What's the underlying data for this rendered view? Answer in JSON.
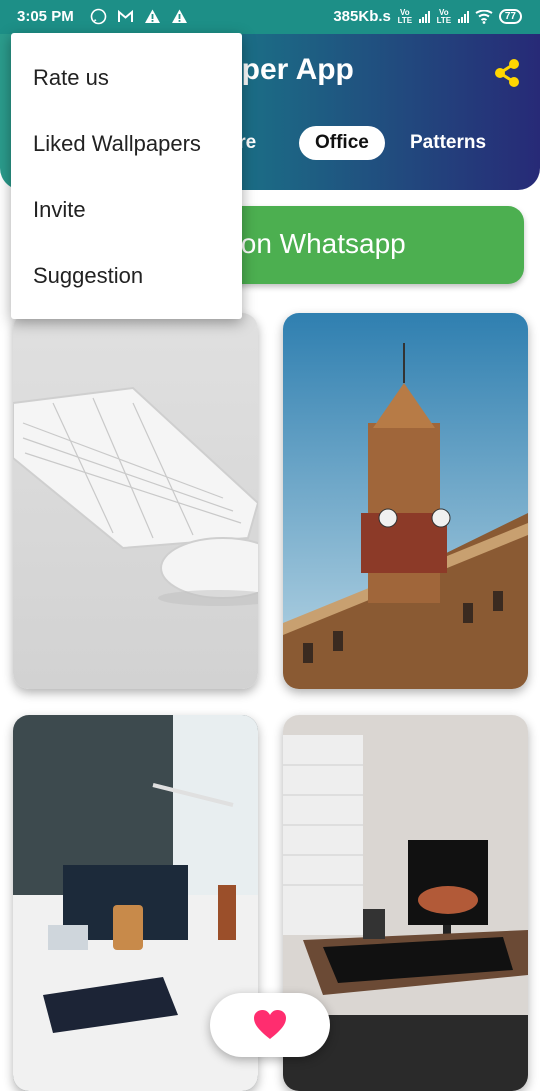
{
  "status_bar": {
    "time": "3:05 PM",
    "speed": "385Kb.s",
    "battery": "77",
    "network_label": "Vo LTE",
    "icons": [
      "whatsapp-icon",
      "gmail-icon",
      "warning-icon",
      "warning-icon",
      "signal-icon",
      "wifi-icon",
      "battery-icon"
    ]
  },
  "header": {
    "title": "Wallpaper App",
    "share_icon": "share-icon",
    "tabs": [
      {
        "label": "Nature",
        "active": false
      },
      {
        "label": "Office",
        "active": true
      },
      {
        "label": "Patterns",
        "active": false
      }
    ]
  },
  "whatsapp_button": {
    "label": "Share on Whatsapp"
  },
  "menu": {
    "items": [
      "Rate us",
      "Liked Wallpapers",
      "Invite",
      "Suggestion"
    ]
  },
  "fab": {
    "icon": "heart-icon"
  },
  "colors": {
    "header_start": "#2b9c8c",
    "header_end": "#272a77",
    "whatsapp_green": "#4caf50",
    "share_yellow": "#ffd600",
    "heart_pink": "#ff2d6f"
  }
}
